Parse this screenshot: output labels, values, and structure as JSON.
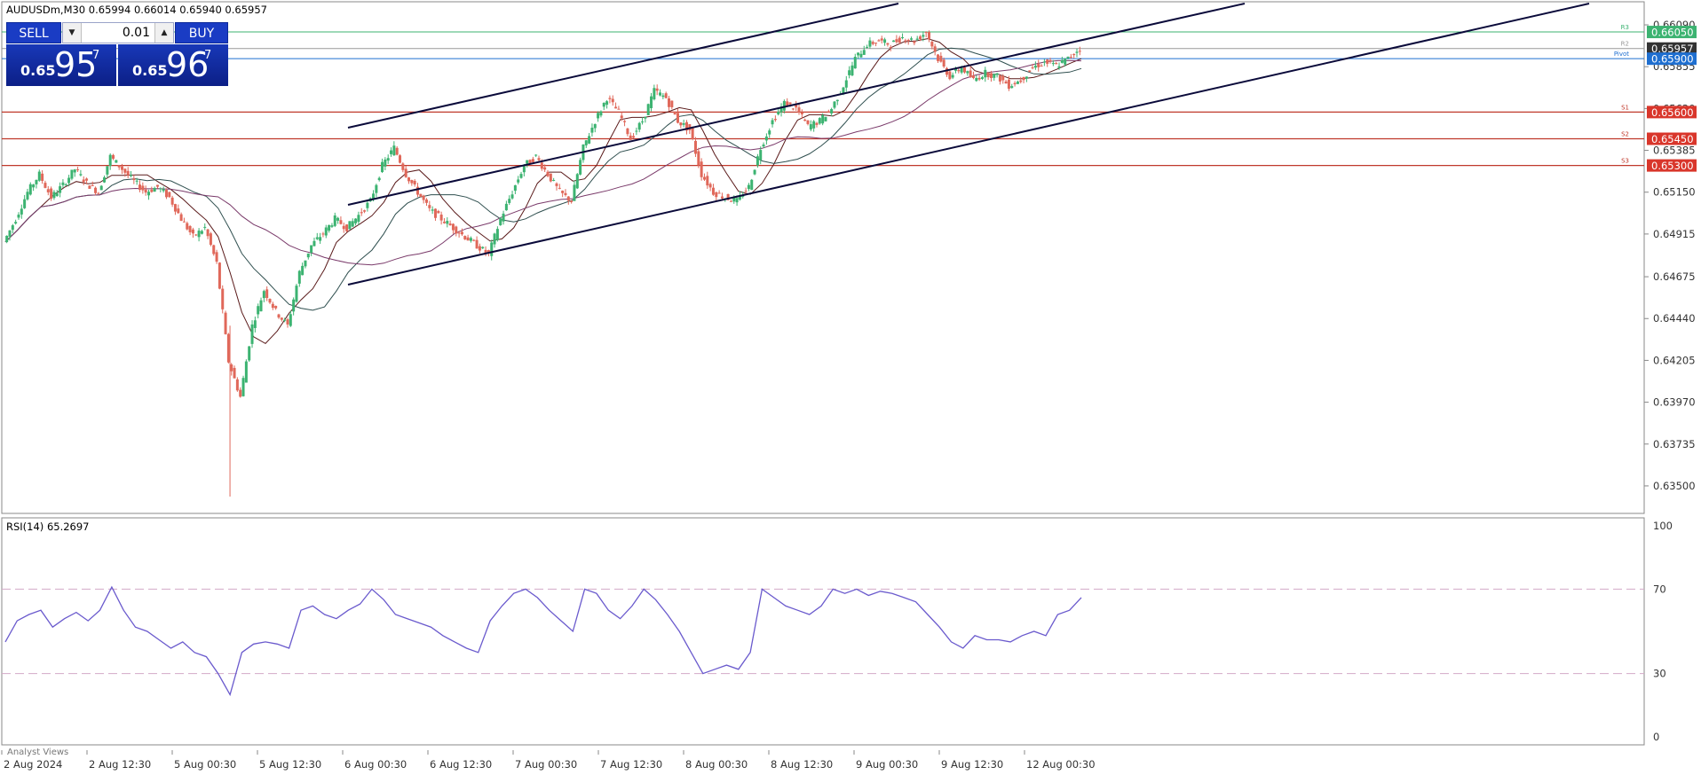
{
  "header": {
    "symbol_info": "AUDUSDm,M30  0.65994 0.66014 0.65940 0.65957"
  },
  "trade_panel": {
    "sell_label": "SELL",
    "buy_label": "BUY",
    "volume": "0.01",
    "sell_small": "0.65",
    "sell_big": "95",
    "sell_sup": "7",
    "buy_small": "0.65",
    "buy_big": "96",
    "buy_sup": "7"
  },
  "price_axis": {
    "ticks": [
      "0.66090",
      "0.65855",
      "0.65620",
      "0.65385",
      "0.65150",
      "0.64915",
      "0.64675",
      "0.64440",
      "0.64205",
      "0.63970",
      "0.63735",
      "0.63500"
    ]
  },
  "level_tags": [
    {
      "text": "0.66050",
      "color": "#3cb371"
    },
    {
      "text": "0.65957",
      "color": "#333333"
    },
    {
      "text": "0.65900",
      "color": "#1f6fd0"
    },
    {
      "text": "0.65600",
      "color": "#d9362b"
    },
    {
      "text": "0.65450",
      "color": "#d9362b"
    },
    {
      "text": "0.65300",
      "color": "#d9362b"
    }
  ],
  "pivot_labels": [
    "R3",
    "R2",
    "Pivot",
    "S1",
    "S2",
    "S3"
  ],
  "rsi": {
    "label": "RSI(14) 65.2697",
    "ticks": [
      "100",
      "70",
      "30",
      "0"
    ]
  },
  "time_axis": [
    "2 Aug 2024",
    "2 Aug 12:30",
    "5 Aug 00:30",
    "5 Aug 12:30",
    "6 Aug 00:30",
    "6 Aug 12:30",
    "7 Aug 00:30",
    "7 Aug 12:30",
    "8 Aug 00:30",
    "8 Aug 12:30",
    "9 Aug 00:30",
    "9 Aug 12:30",
    "12 Aug 00:30"
  ],
  "footer": {
    "analyst_views": "Analyst Views"
  },
  "colors": {
    "bull": "#3cb371",
    "bear": "#e0685a",
    "rsi_line": "#6a5acd",
    "accent": "#1a3cc4"
  },
  "chart_data": {
    "type": "candlestick",
    "symbol": "AUDUSDm",
    "timeframe": "M30",
    "ylim": [
      0.6342,
      0.6613
    ],
    "x_labels": [
      "2 Aug 2024",
      "2 Aug 12:30",
      "5 Aug 00:30",
      "5 Aug 12:30",
      "6 Aug 00:30",
      "6 Aug 12:30",
      "7 Aug 00:30",
      "7 Aug 12:30",
      "8 Aug 00:30",
      "8 Aug 12:30",
      "9 Aug 00:30",
      "9 Aug 12:30",
      "12 Aug 00:30"
    ],
    "close_path": [
      0.6487,
      0.65,
      0.6515,
      0.6525,
      0.6512,
      0.6519,
      0.6528,
      0.652,
      0.6515,
      0.6535,
      0.6528,
      0.6521,
      0.6515,
      0.6518,
      0.6512,
      0.65,
      0.649,
      0.6495,
      0.6475,
      0.642,
      0.64,
      0.644,
      0.646,
      0.6448,
      0.644,
      0.647,
      0.6485,
      0.6492,
      0.65,
      0.6495,
      0.6502,
      0.651,
      0.653,
      0.654,
      0.6525,
      0.6515,
      0.6505,
      0.65,
      0.6495,
      0.649,
      0.6485,
      0.648,
      0.65,
      0.6515,
      0.653,
      0.6535,
      0.6525,
      0.6515,
      0.651,
      0.654,
      0.6555,
      0.6568,
      0.656,
      0.6545,
      0.6555,
      0.6572,
      0.6568,
      0.6555,
      0.655,
      0.6525,
      0.6515,
      0.6512,
      0.651,
      0.6518,
      0.654,
      0.6555,
      0.6565,
      0.6562,
      0.6552,
      0.6555,
      0.6562,
      0.6575,
      0.659,
      0.6598,
      0.66,
      0.6598,
      0.6602,
      0.66,
      0.6605,
      0.659,
      0.658,
      0.6585,
      0.6578,
      0.6582,
      0.658,
      0.6575,
      0.6578,
      0.6585,
      0.6588,
      0.6586,
      0.659,
      0.6596
    ],
    "overlay_levels": [
      {
        "label": "R3",
        "value": 0.6605
      },
      {
        "label": "R2",
        "value": 0.65957
      },
      {
        "label": "Pivot",
        "value": 0.659
      },
      {
        "label": "S1",
        "value": 0.656
      },
      {
        "label": "S2",
        "value": 0.6545
      },
      {
        "label": "S3",
        "value": 0.653
      }
    ],
    "rsi": {
      "period": 14,
      "last": 65.2697,
      "levels": [
        70,
        30
      ],
      "range": [
        0,
        100
      ],
      "values": [
        45,
        55,
        58,
        60,
        52,
        56,
        59,
        55,
        60,
        71,
        60,
        52,
        50,
        46,
        42,
        45,
        40,
        38,
        30,
        20,
        40,
        44,
        45,
        44,
        42,
        60,
        62,
        58,
        56,
        60,
        63,
        70,
        65,
        58,
        56,
        54,
        52,
        48,
        45,
        42,
        40,
        55,
        62,
        68,
        70,
        66,
        60,
        55,
        50,
        70,
        68,
        60,
        56,
        62,
        70,
        65,
        58,
        50,
        40,
        30,
        32,
        34,
        32,
        40,
        70,
        66,
        62,
        60,
        58,
        62,
        70,
        68,
        70,
        67,
        69,
        68,
        66,
        64,
        58,
        52,
        45,
        42,
        48,
        46,
        46,
        45,
        48,
        50,
        48,
        58,
        60,
        66
      ]
    }
  }
}
